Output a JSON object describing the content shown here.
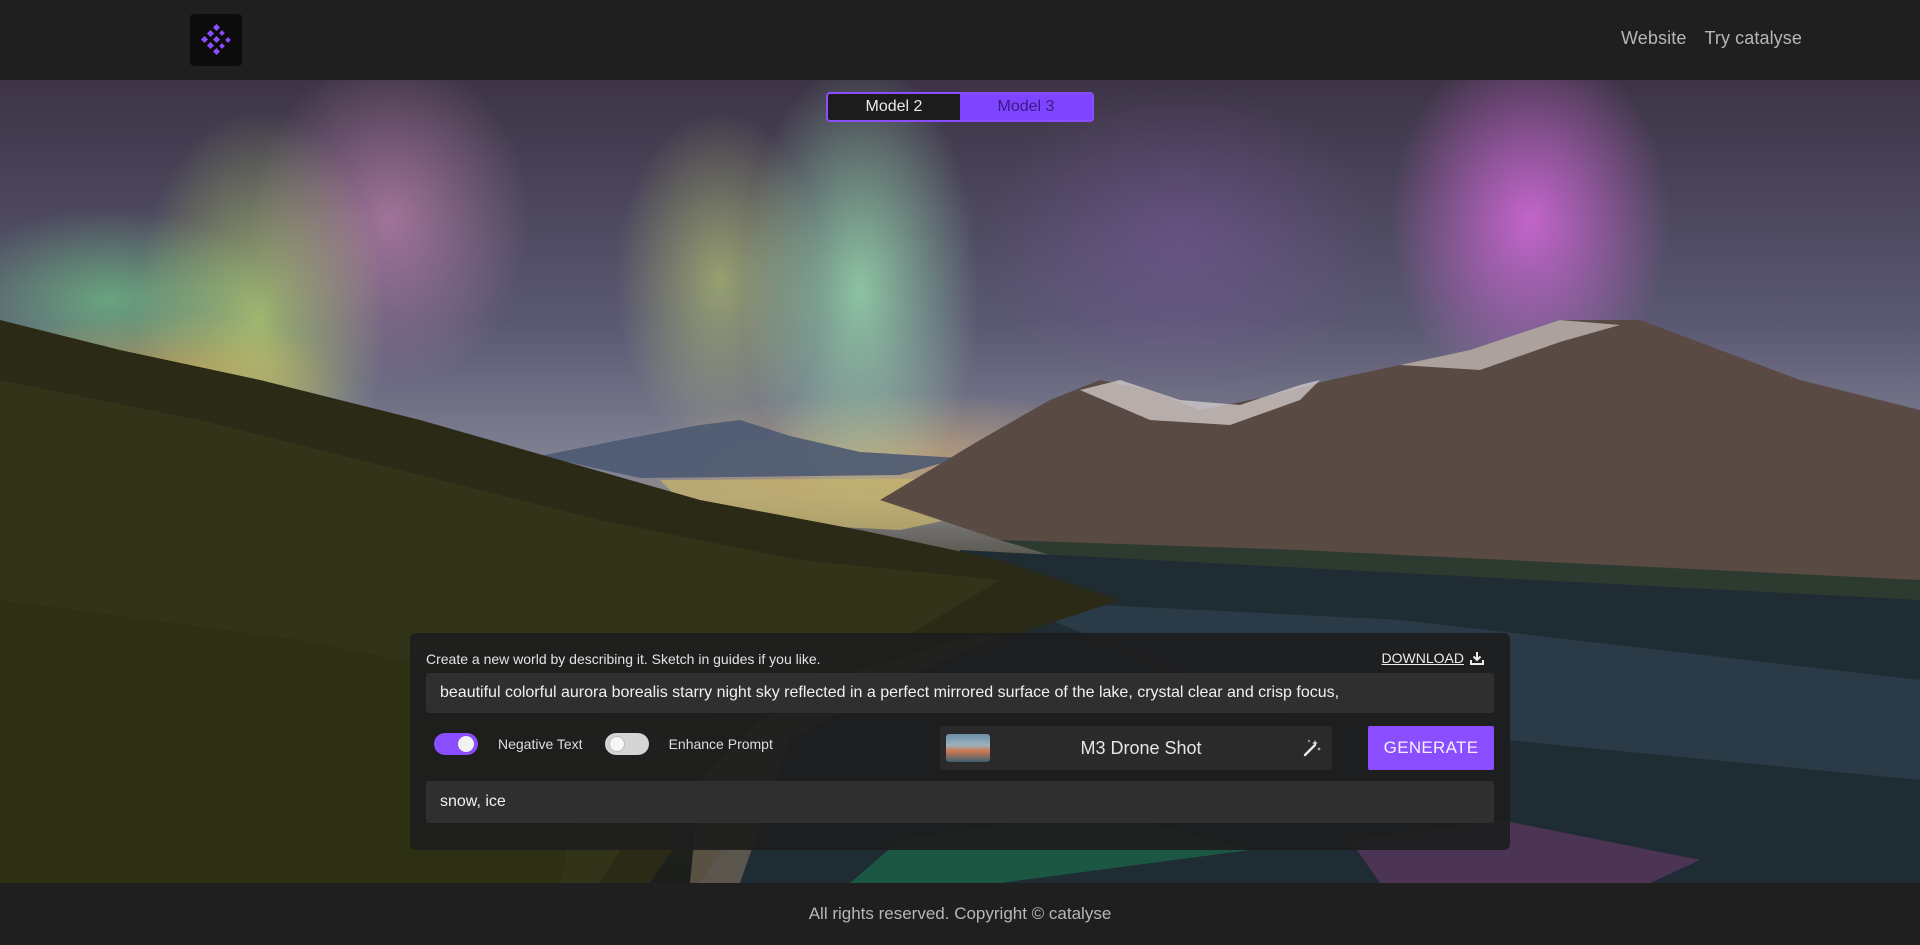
{
  "header": {
    "logo_icon": "catalyse-logo-icon",
    "nav": [
      {
        "label": "Website"
      },
      {
        "label": "Try catalyse"
      }
    ]
  },
  "hero": {
    "image_subject": "aurora borealis over mountain lake"
  },
  "model_switch": {
    "options": [
      "Model 2",
      "Model 3"
    ],
    "selected": "Model 3"
  },
  "panel": {
    "hint": "Create a new world by describing it. Sketch in guides if you like.",
    "download_label": "DOWNLOAD",
    "download_icon": "download-icon",
    "prompt_value": "beautiful colorful aurora borealis starry night sky reflected in a perfect mirrored surface of the lake, crystal clear and crisp focus,",
    "negative_toggle": {
      "label": "Negative Text",
      "state": "on"
    },
    "enhance_toggle": {
      "label": "Enhance Prompt",
      "state": "off"
    },
    "style": {
      "name": "M3 Drone Shot",
      "icon": "magic-wand-icon"
    },
    "generate_label": "GENERATE",
    "negative_value": "snow, ice"
  },
  "footer": {
    "copyright": "All rights reserved. Copyright © catalyse"
  },
  "colors": {
    "accent": "#8a4dff",
    "background": "#1f1f1f",
    "panel": "#1e1e1e"
  }
}
